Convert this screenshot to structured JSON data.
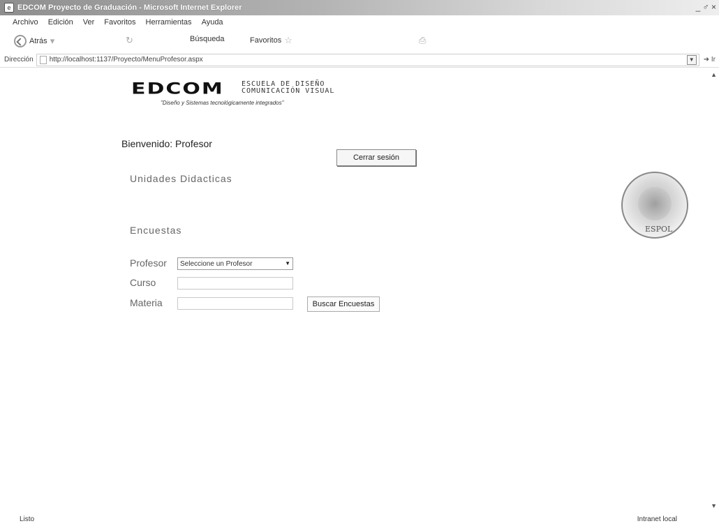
{
  "window": {
    "title": "EDCOM Proyecto de Graduación - Microsoft Internet Explorer",
    "controls": "_ ♂ ×"
  },
  "menu": {
    "items": [
      "Archivo",
      "Edición",
      "Ver",
      "Favoritos",
      "Herramientas",
      "Ayuda"
    ]
  },
  "toolbar": {
    "back_label": "Atrás",
    "search_label": "Búsqueda",
    "favorites_label": "Favoritos"
  },
  "address": {
    "label": "Dirección",
    "url": "http://localhost:1137/Proyecto/MenuProfesor.aspx",
    "go_label": "Ir"
  },
  "logo": {
    "brand": "EDCOM",
    "school_line1": "ESCUELA DE DISEÑO",
    "school_line2": "COMUNICACIÓN VISUAL",
    "tagline": "\"Diseño y Sistemas tecnológicamente integrados\""
  },
  "page": {
    "welcome": "Bienvenido: Profesor",
    "logout_label": "Cerrar sesión",
    "section_units": "Unidades Didacticas",
    "section_surveys": "Encuestas"
  },
  "form": {
    "profesor_label": "Profesor",
    "profesor_selected": "Seleccione un Profesor",
    "curso_label": "Curso",
    "curso_value": "",
    "materia_label": "Materia",
    "materia_value": "",
    "search_label": "Buscar Encuestas"
  },
  "seal": {
    "text": "ESPOL"
  },
  "statusbar": {
    "left": "Listo",
    "right": "Intranet local"
  },
  "icons": [
    "ie-page-icon",
    "back-icon",
    "search-icon",
    "favorites-icon",
    "dropdown-arrow-icon",
    "go-arrow-icon",
    "scroll-up-icon",
    "scroll-down-icon"
  ]
}
